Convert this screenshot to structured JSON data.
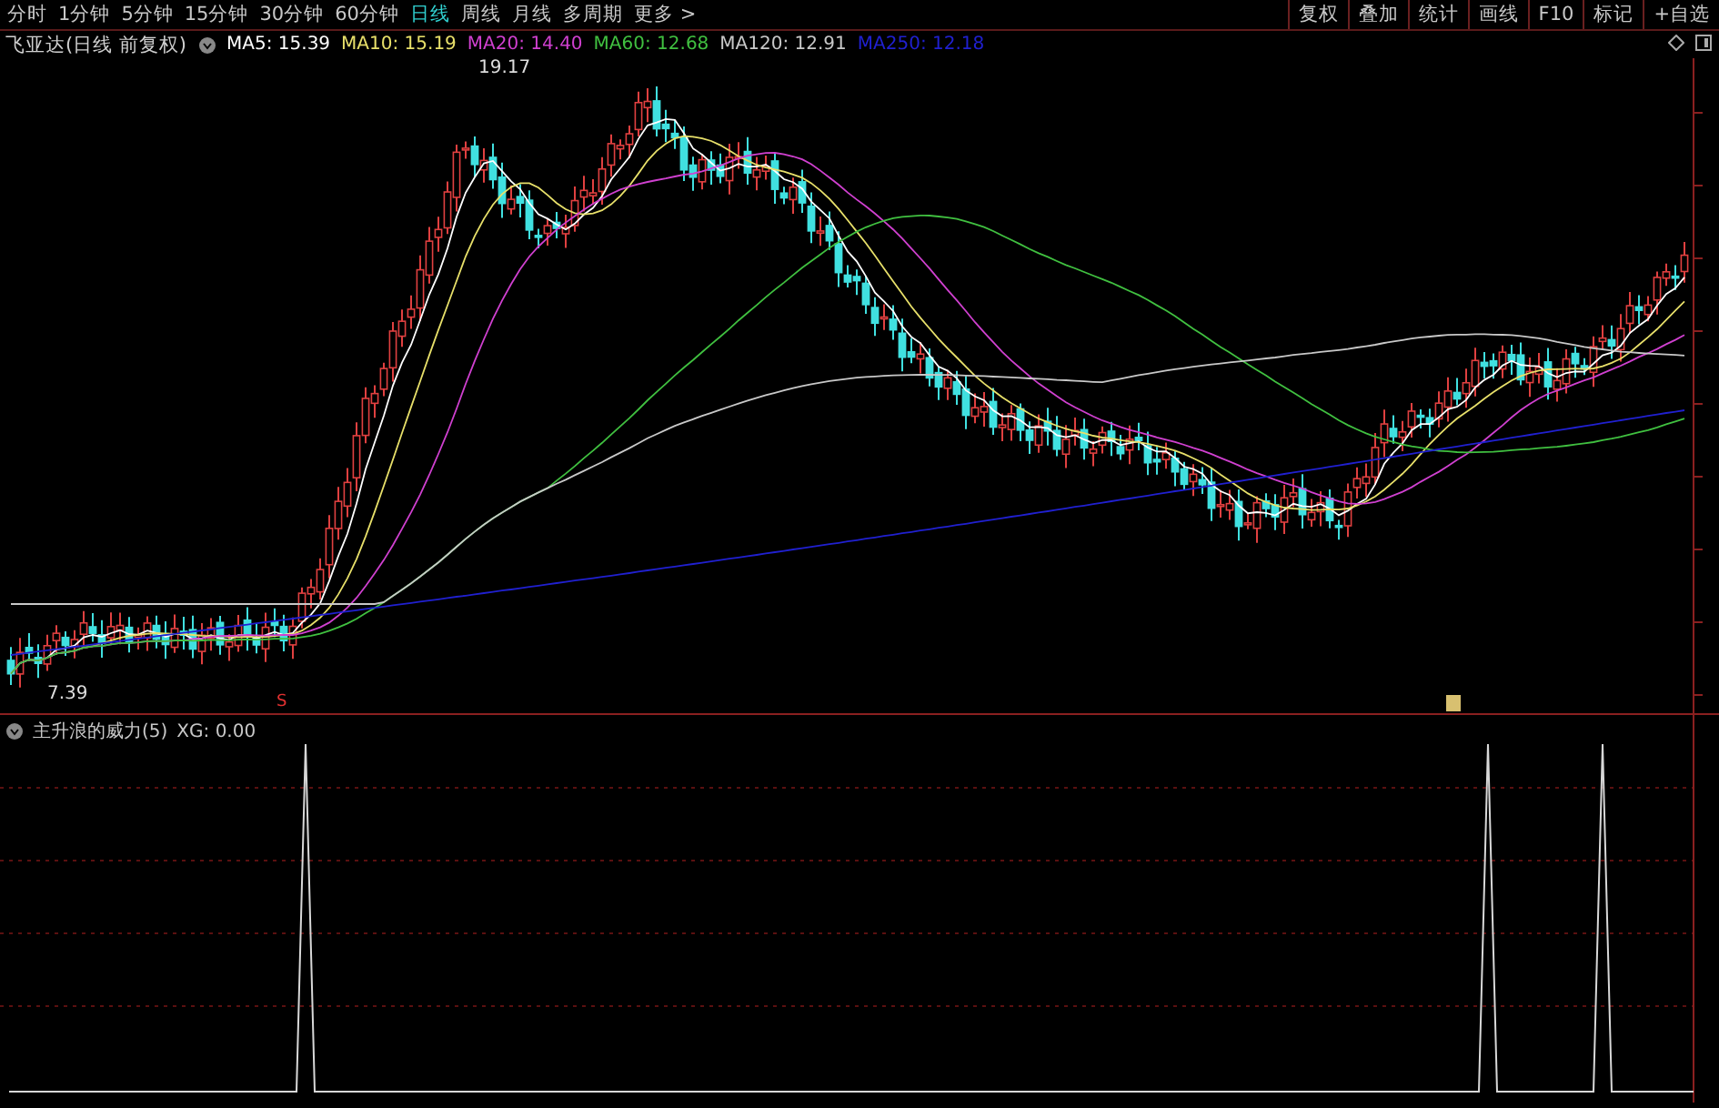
{
  "toolbar": {
    "periods": [
      {
        "label": "分时",
        "selected": false
      },
      {
        "label": "1分钟",
        "selected": false
      },
      {
        "label": "5分钟",
        "selected": false
      },
      {
        "label": "15分钟",
        "selected": false
      },
      {
        "label": "30分钟",
        "selected": false
      },
      {
        "label": "60分钟",
        "selected": false
      },
      {
        "label": "日线",
        "selected": true
      },
      {
        "label": "周线",
        "selected": false
      },
      {
        "label": "月线",
        "selected": false
      },
      {
        "label": "多周期",
        "selected": false
      },
      {
        "label": "更多 >",
        "selected": false
      }
    ],
    "actions": [
      "复权",
      "叠加",
      "统计",
      "画线",
      "F10",
      "标记",
      "+自选"
    ]
  },
  "legend": {
    "title": "飞亚达(日线 前复权)",
    "averages": [
      {
        "label": "MA5: 15.39",
        "color": "#ffffff"
      },
      {
        "label": "MA10: 15.19",
        "color": "#e8e06a"
      },
      {
        "label": "MA20: 14.40",
        "color": "#d040d0"
      },
      {
        "label": "MA60: 12.68",
        "color": "#40c040"
      },
      {
        "label": "MA120: 12.91",
        "color": "#c8c8c8"
      },
      {
        "label": "MA250: 12.18",
        "color": "#2020d0"
      }
    ]
  },
  "main_chart": {
    "high_label": "19.17",
    "low_label": "7.39",
    "signal_label": "S"
  },
  "indicator": {
    "title": "主升浪的威力(5)",
    "reading": "XG: 0.00"
  }
}
